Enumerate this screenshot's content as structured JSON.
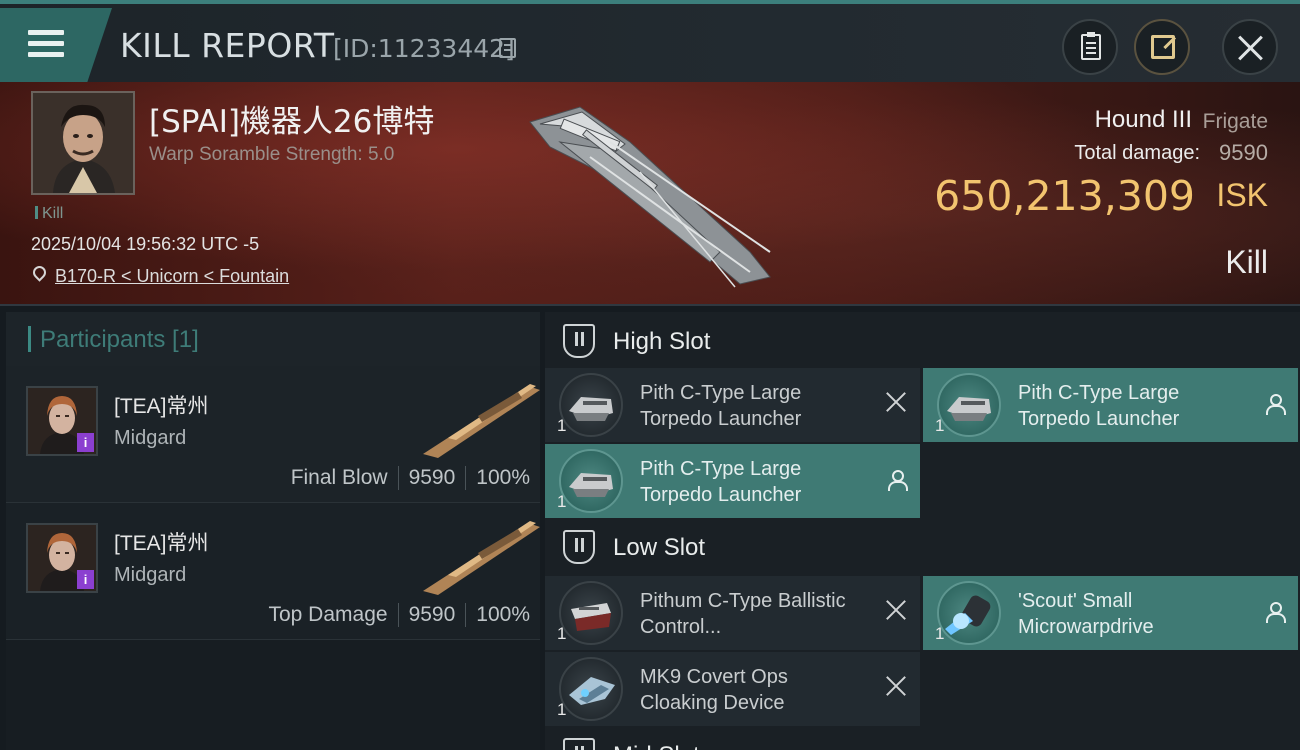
{
  "header": {
    "title": "KILL REPORT",
    "report_id": "[ID:11233442]"
  },
  "victim": {
    "name": "[SPAI]機器人26博特",
    "warp_scramble": "Warp Soramble Strength: 5.0",
    "tag": "Kill",
    "timestamp": "2025/10/04 19:56:32 UTC -5",
    "location": "B170-R < Unicorn < Fountain",
    "ship_name": "Hound III",
    "ship_class": "Frigate",
    "total_damage_label": "Total damage:",
    "total_damage": "9590",
    "isk_value": "650,213,309",
    "isk_label": "ISK",
    "outcome": "Kill"
  },
  "participants": {
    "title": "Participants [1]",
    "rows": [
      {
        "name": "[TEA]常州",
        "ship": "Midgard",
        "role": "Final Blow",
        "damage": "9590",
        "percent": "100%",
        "badge": "i"
      },
      {
        "name": "[TEA]常州",
        "ship": "Midgard",
        "role": "Top Damage",
        "damage": "9590",
        "percent": "100%",
        "badge": "i"
      }
    ]
  },
  "slots": {
    "high": {
      "title": "High Slot",
      "modules": [
        {
          "name": "Pith C-Type Large Torpedo Launcher",
          "qty": "1",
          "state": "destroyed"
        },
        {
          "name": "Pith C-Type Large Torpedo Launcher",
          "qty": "1",
          "state": "dropped"
        },
        {
          "name": "Pith C-Type Large Torpedo Launcher",
          "qty": "1",
          "state": "dropped"
        }
      ]
    },
    "low": {
      "title": "Low Slot",
      "modules": [
        {
          "name": "Pithum C-Type Ballistic Control...",
          "qty": "1",
          "state": "destroyed"
        },
        {
          "name": "'Scout' Small Microwarpdrive",
          "qty": "1",
          "state": "dropped"
        },
        {
          "name": "MK9 Covert Ops Cloaking Device",
          "qty": "1",
          "state": "destroyed"
        }
      ]
    },
    "mid": {
      "title": "Mid Slot"
    }
  },
  "colors": {
    "accent": "#3c7f7c",
    "isk": "#f2c46f",
    "dropped_highlight": "#3f7a74",
    "badge": "#8b3fd0"
  },
  "icons": {
    "menu": "menu-icon",
    "copy": "copy-icon",
    "clipboard": "clipboard-icon",
    "share": "share-icon",
    "close": "close-icon",
    "location": "pin-icon",
    "slot": "slot-icon",
    "destroyed": "close-icon",
    "dropped": "person-icon"
  }
}
